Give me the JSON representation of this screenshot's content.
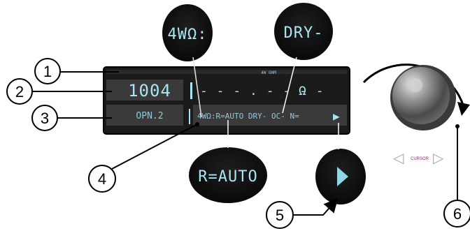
{
  "display": {
    "top_label": "4W OHM",
    "row1_value": "1004",
    "row1_reading": "- - - . - - - -",
    "row1_unit": "Ω",
    "row2_label": "OPN.2",
    "row2_status": "4WΩ:R=AUTO DRY- OC- N=",
    "row2_arrow": "▶"
  },
  "zoom_bubbles": {
    "mode": "4WΩ:",
    "dry": "DRY-",
    "range": "R=AUTO",
    "next": "▶"
  },
  "knob": {
    "caption": "CURSOR",
    "left_arrow": "◁",
    "right_arrow": "▷"
  },
  "callouts": [
    "1",
    "2",
    "3",
    "4",
    "5",
    "6"
  ],
  "colors": {
    "panel": "#1b1b1b",
    "lcd_text": "#a9e4f2",
    "field_bg": "#3a3a3a"
  }
}
